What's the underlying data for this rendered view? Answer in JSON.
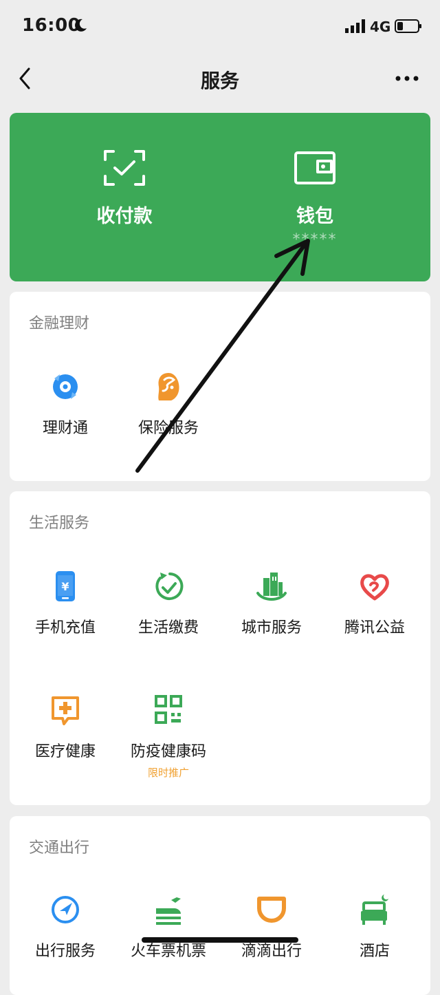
{
  "status_bar": {
    "time": "16:00",
    "network": "4G"
  },
  "nav": {
    "title": "服务"
  },
  "green_card": {
    "pay": {
      "label": "收付款",
      "icon": "scan-check-icon"
    },
    "wallet": {
      "label": "钱包",
      "balance_masked": "*****",
      "icon": "wallet-icon"
    }
  },
  "sections": {
    "finance": {
      "title": "金融理财",
      "items": [
        {
          "label": "理财通",
          "icon": "licaitong-icon",
          "color": "#2b8ff0"
        },
        {
          "label": "保险服务",
          "icon": "insurance-icon",
          "color": "#f0962e"
        }
      ]
    },
    "life": {
      "title": "生活服务",
      "items": [
        {
          "label": "手机充值",
          "icon": "phone-recharge-icon",
          "color": "#2b8ff0"
        },
        {
          "label": "生活缴费",
          "icon": "bill-pay-icon",
          "color": "#3ca957"
        },
        {
          "label": "城市服务",
          "icon": "city-service-icon",
          "color": "#3ca957"
        },
        {
          "label": "腾讯公益",
          "icon": "charity-heart-icon",
          "color": "#e84a4a"
        },
        {
          "label": "医疗健康",
          "icon": "medical-icon",
          "color": "#f0962e"
        },
        {
          "label": "防疫健康码",
          "tag": "限时推广",
          "icon": "health-qr-icon",
          "color": "#3ca957"
        }
      ]
    },
    "transport": {
      "title": "交通出行",
      "items": [
        {
          "label": "出行服务",
          "icon": "navigation-icon",
          "color": "#2b8ff0"
        },
        {
          "label": "火车票机票",
          "icon": "train-plane-icon",
          "color": "#3ca957"
        },
        {
          "label": "滴滴出行",
          "icon": "didi-icon",
          "color": "#f0962e"
        },
        {
          "label": "酒店",
          "icon": "hotel-bed-icon",
          "color": "#3ca957"
        }
      ]
    }
  }
}
